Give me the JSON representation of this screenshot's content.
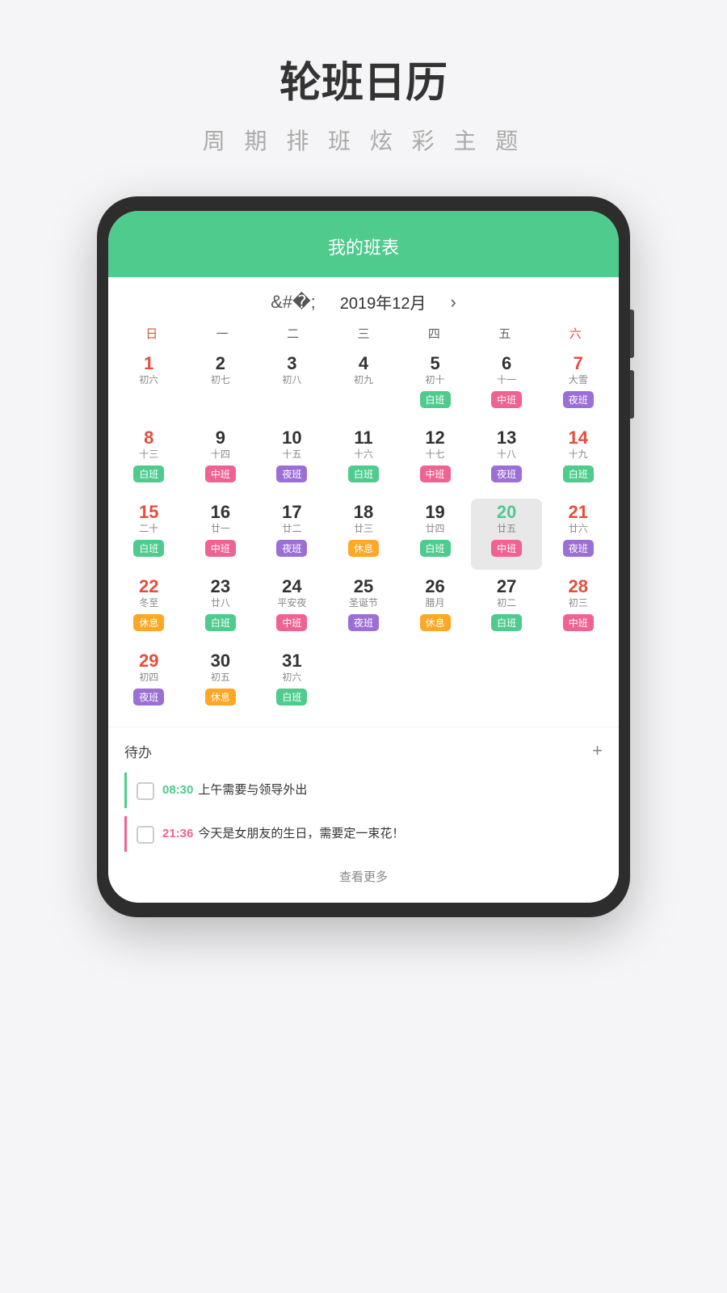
{
  "header": {
    "title": "轮班日历",
    "subtitle": "周 期 排 班   炫 彩 主 题"
  },
  "calendar": {
    "app_title": "我的班表",
    "month_label": "2019年12月",
    "weekdays": [
      "日",
      "一",
      "二",
      "三",
      "四",
      "五",
      "六"
    ],
    "rows": [
      [
        {
          "date": "1",
          "lunar": "初六",
          "badge": "",
          "badge_class": "",
          "date_class": "red"
        },
        {
          "date": "2",
          "lunar": "初七",
          "badge": "",
          "badge_class": "",
          "date_class": ""
        },
        {
          "date": "3",
          "lunar": "初八",
          "badge": "",
          "badge_class": "",
          "date_class": ""
        },
        {
          "date": "4",
          "lunar": "初九",
          "badge": "",
          "badge_class": "",
          "date_class": ""
        },
        {
          "date": "5",
          "lunar": "初十",
          "badge": "白班",
          "badge_class": "badge-green",
          "date_class": ""
        },
        {
          "date": "6",
          "lunar": "十一",
          "badge": "中班",
          "badge_class": "badge-pink",
          "date_class": ""
        },
        {
          "date": "7",
          "lunar": "大雪",
          "badge": "夜班",
          "badge_class": "badge-purple",
          "date_class": "red"
        }
      ],
      [
        {
          "date": "8",
          "lunar": "十三",
          "badge": "白班",
          "badge_class": "badge-green",
          "date_class": "red"
        },
        {
          "date": "9",
          "lunar": "十四",
          "badge": "中班",
          "badge_class": "badge-pink",
          "date_class": ""
        },
        {
          "date": "10",
          "lunar": "十五",
          "badge": "夜班",
          "badge_class": "badge-purple",
          "date_class": ""
        },
        {
          "date": "11",
          "lunar": "十六",
          "badge": "白班",
          "badge_class": "badge-green",
          "date_class": ""
        },
        {
          "date": "12",
          "lunar": "十七",
          "badge": "中班",
          "badge_class": "badge-pink",
          "date_class": ""
        },
        {
          "date": "13",
          "lunar": "十八",
          "badge": "夜班",
          "badge_class": "badge-purple",
          "date_class": ""
        },
        {
          "date": "14",
          "lunar": "十九",
          "badge": "白班",
          "badge_class": "badge-green",
          "date_class": "red"
        }
      ],
      [
        {
          "date": "15",
          "lunar": "二十",
          "badge": "白班",
          "badge_class": "badge-green",
          "date_class": "red"
        },
        {
          "date": "16",
          "lunar": "廿一",
          "badge": "中班",
          "badge_class": "badge-pink",
          "date_class": ""
        },
        {
          "date": "17",
          "lunar": "廿二",
          "badge": "夜班",
          "badge_class": "badge-purple",
          "date_class": ""
        },
        {
          "date": "18",
          "lunar": "廿三",
          "badge": "休息",
          "badge_class": "badge-orange",
          "date_class": ""
        },
        {
          "date": "19",
          "lunar": "廿四",
          "badge": "白班",
          "badge_class": "badge-green",
          "date_class": ""
        },
        {
          "date": "20",
          "lunar": "廿五",
          "badge": "中班",
          "badge_class": "badge-pink",
          "date_class": "green",
          "highlight": true
        },
        {
          "date": "21",
          "lunar": "廿六",
          "badge": "夜班",
          "badge_class": "badge-purple",
          "date_class": "red"
        }
      ],
      [
        {
          "date": "22",
          "lunar": "冬至",
          "badge": "休息",
          "badge_class": "badge-orange",
          "date_class": "red"
        },
        {
          "date": "23",
          "lunar": "廿八",
          "badge": "白班",
          "badge_class": "badge-green",
          "date_class": ""
        },
        {
          "date": "24",
          "lunar": "平安夜",
          "badge": "中班",
          "badge_class": "badge-pink",
          "date_class": ""
        },
        {
          "date": "25",
          "lunar": "圣诞节",
          "badge": "夜班",
          "badge_class": "badge-purple",
          "date_class": ""
        },
        {
          "date": "26",
          "lunar": "腊月",
          "badge": "休息",
          "badge_class": "badge-orange",
          "date_class": ""
        },
        {
          "date": "27",
          "lunar": "初二",
          "badge": "白班",
          "badge_class": "badge-green",
          "date_class": ""
        },
        {
          "date": "28",
          "lunar": "初三",
          "badge": "中班",
          "badge_class": "badge-pink",
          "date_class": "red"
        }
      ],
      [
        {
          "date": "29",
          "lunar": "初四",
          "badge": "夜班",
          "badge_class": "badge-purple",
          "date_class": "red"
        },
        {
          "date": "30",
          "lunar": "初五",
          "badge": "休息",
          "badge_class": "badge-orange",
          "date_class": ""
        },
        {
          "date": "31",
          "lunar": "初六",
          "badge": "白班",
          "badge_class": "badge-green",
          "date_class": ""
        },
        null,
        null,
        null,
        null
      ]
    ]
  },
  "todo": {
    "title": "待办",
    "add_icon": "+",
    "items": [
      {
        "time": "08:30",
        "text": "上午需要与领导外出"
      },
      {
        "time": "21:36",
        "text": "今天是女朋友的生日，需要定一束花！"
      }
    ],
    "more_label": "查看更多"
  }
}
